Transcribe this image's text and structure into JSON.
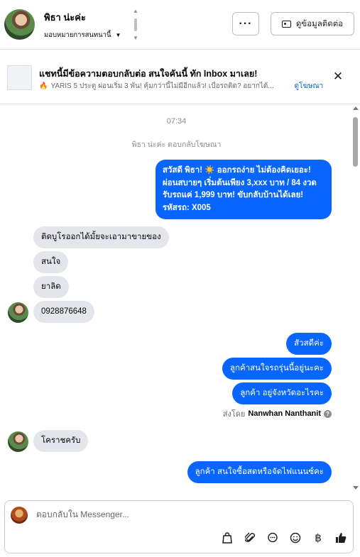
{
  "header": {
    "contact_name": "พิธา น่ะค่ะ",
    "assignee_label": "มอบหมายการสนทนานี้",
    "more_label": "···",
    "contact_info_label": "ดูข้อมูลติดต่อ"
  },
  "ad": {
    "title": "แชทนี้มีข้อความตอบกลับต่อ สนใจคันนี้ ทัก Inbox มาเลย!",
    "subtitle": "YARIS 5 ประตู ผ่อนเริ่ม 3 พัน! คุ้มกว่านี้ไม่มีอีกแล้ว! เบื่อรถติด? อยากได้...",
    "link_label": "ดูโฆษณา",
    "close_label": "✕"
  },
  "conversation": {
    "timestamp": "07:34",
    "reply_note": "พิธา น่ะค่ะ ตอบกลับโฆษณา",
    "ad_message": [
      "สวัสดี พิธา! ☀️ ออกรถง่าย ไม่ต้องคิดเยอะ!",
      "ผ่อนสบายๆ เริ่มต้นเพียง 3,xxx บาท / 84 งวด",
      "รับรถแค่ 1,999 บาท! ขับกลับบ้านได้เลย!",
      "รหัสรถ: X005"
    ],
    "incoming_1": "ติดบูโรออกได้มั้ยจะเอามาขายของ",
    "incoming_2": "สนใจ",
    "incoming_3": "ยาลิด",
    "incoming_4": "0928876648",
    "outgoing_1": "สัวสดีค่ะ",
    "outgoing_2": "ลูกค้าสนใจรถรุ่นนี้อยู่นะคะ",
    "outgoing_3": "ลูกค้า อยู่จังหวัดอะไรคะ",
    "sent_by_prefix": "ส่งโดย",
    "sent_by_name": "Nanwhan Nanthanit",
    "incoming_5": "โคราชครับ",
    "outgoing_4": "ลูกค้า สนใจซื้อสดหรือจัดไฟแนนซ์คะ"
  },
  "composer": {
    "placeholder": "ตอบกลับใน Messenger...",
    "tools": [
      "bag-icon",
      "paperclip-icon",
      "chat-bubble-icon",
      "smiley-icon",
      "baht-icon",
      "thumbs-up-icon"
    ]
  }
}
